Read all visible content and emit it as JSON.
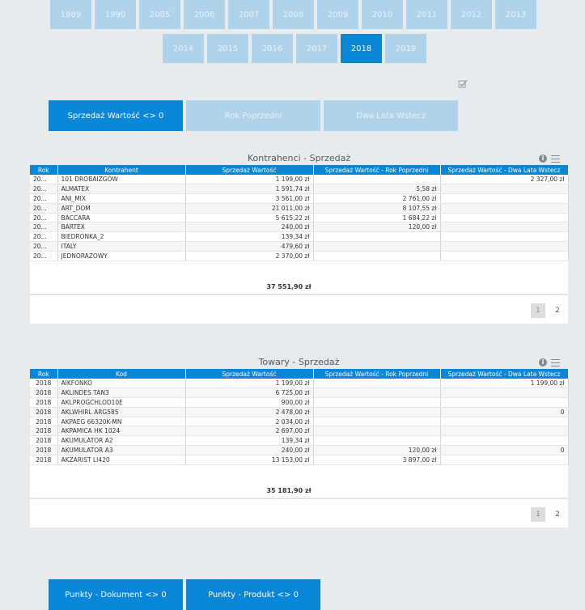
{
  "years_row1": [
    "1989",
    "1990",
    "2005",
    "2006",
    "2007",
    "2008",
    "2009",
    "2010",
    "2011",
    "2012",
    "2013"
  ],
  "years_row2": [
    "2014",
    "2015",
    "2016",
    "2017",
    "2018",
    "2019"
  ],
  "active_year": "2018",
  "tabs": {
    "sales_value": "Sprzedaż Wartość <> 0",
    "prev_year": "Rok Poprzedni",
    "two_years": "Dwa Lata Wstecz"
  },
  "kontrahenci": {
    "title": "Kontrahenci - Sprzedaż",
    "headers": [
      "Rok",
      "Kontrahent",
      "Sprzedaż Wartość",
      "Sprzedaż Wartość - Rok Poprzedni",
      "Sprzedaż Wartość - Dwa Lata Wstecz"
    ],
    "rows": [
      [
        "20...",
        "101 DROBAIZGÓW",
        "1 199,00 zł",
        "",
        "2 327,00 zł"
      ],
      [
        "20...",
        "ALMATEX",
        "1 591,74 zł",
        "5,58 zł",
        ""
      ],
      [
        "20...",
        "ANI_MIX",
        "3 561,00 zł",
        "2 761,00 zł",
        ""
      ],
      [
        "20...",
        "ART_DOM",
        "21 011,00 zł",
        "8 107,55 zł",
        ""
      ],
      [
        "20...",
        "BACCARA",
        "5 615,22 zł",
        "1 684,22 zł",
        ""
      ],
      [
        "20...",
        "BARTEX",
        "240,00 zł",
        "120,00 zł",
        ""
      ],
      [
        "20...",
        "BIEDRONKA_2",
        "139,34 zł",
        "",
        ""
      ],
      [
        "20...",
        "ITALY",
        "479,60 zł",
        "",
        ""
      ],
      [
        "20...",
        "JEDNORAZOWY",
        "2 370,00 zł",
        "",
        ""
      ]
    ],
    "total": "37 551,90 zł",
    "pages": [
      "1",
      "2"
    ]
  },
  "towary": {
    "title": "Towary - Sprzedaż",
    "headers": [
      "Rok",
      "Kod",
      "Sprzedaż Wartość",
      "Sprzedaż Wartość - Rok Poprzedni",
      "Sprzedaż Wartość - Dwa Lata Wstecz"
    ],
    "rows": [
      [
        "2018",
        "AIKFONKO",
        "1 199,00 zł",
        "",
        "1 199,00 zł"
      ],
      [
        "2018",
        "AKLINDES TAN3",
        "6 725,00 zł",
        "",
        ""
      ],
      [
        "2018",
        "AKLPROGCHLOD10E",
        "900,00 zł",
        "",
        ""
      ],
      [
        "2018",
        "AKLWHIRL ARG585",
        "2 478,00 zł",
        "",
        "0"
      ],
      [
        "2018",
        "AKPAEG 66320K-MN",
        "2 034,00 zł",
        "",
        ""
      ],
      [
        "2018",
        "AKPAMICA HK 1024",
        "2 697,00 zł",
        "",
        ""
      ],
      [
        "2018",
        "AKUMULATOR A2",
        "139,34 zł",
        "",
        ""
      ],
      [
        "2018",
        "AKUMULATOR A3",
        "240,00 zł",
        "120,00 zł",
        "0"
      ],
      [
        "2018",
        "AKZARIST LI420",
        "13 153,00 zł",
        "3 897,00 zł",
        ""
      ]
    ],
    "total": "35 181,90 zł",
    "pages": [
      "1",
      "2"
    ]
  },
  "bottom_buttons": {
    "doc_points": "Punkty - Dokument <> 0",
    "product_points": "Punkty - Produkt <> 0"
  }
}
